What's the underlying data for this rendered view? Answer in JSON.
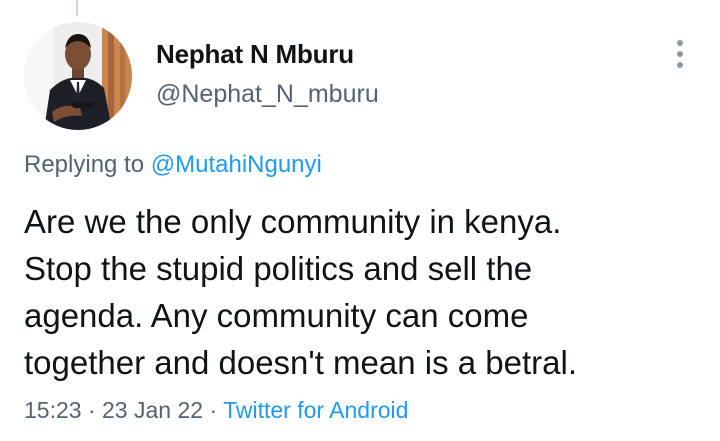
{
  "tweet": {
    "author": {
      "display_name": "Nephat N Mburu",
      "handle": "@Nephat_N_mburu",
      "avatar": "profile-photo"
    },
    "replying_to": {
      "prefix": "Replying to",
      "mention": "@MutahiNgunyi"
    },
    "text": "Are we the only community in kenya.\nStop the stupid politics and sell the\nagenda. Any community can come\ntogether and doesn't mean is a betral.",
    "time": "15:23",
    "separator": "·",
    "date": "23 Jan 22",
    "source": "Twitter for Android"
  },
  "icons": {
    "more": "more-vertical-icon"
  },
  "colors": {
    "link": "#1d9bf0",
    "secondary_text": "#536471",
    "primary_text": "#0f1419"
  }
}
